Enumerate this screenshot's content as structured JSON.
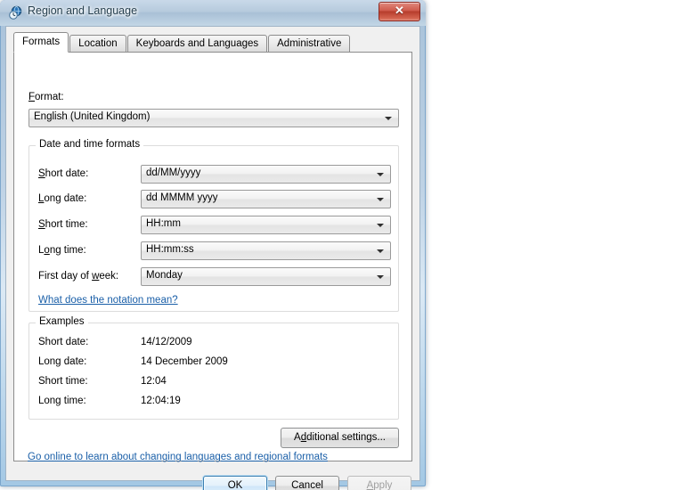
{
  "window": {
    "title": "Region and Language",
    "icon": "globe-clock-icon",
    "close_glyph": "✕"
  },
  "tabs": [
    {
      "label": "Formats",
      "active": true
    },
    {
      "label": "Location",
      "active": false
    },
    {
      "label": "Keyboards and Languages",
      "active": false
    },
    {
      "label": "Administrative",
      "active": false
    }
  ],
  "format_section": {
    "label_pre": "F",
    "label_post": "ormat:",
    "value": "English (United Kingdom)"
  },
  "datetime_group": {
    "title": "Date and time formats",
    "rows": [
      {
        "label_pre": "",
        "label_key": "S",
        "label_post": "hort date:",
        "value": "dd/MM/yyyy"
      },
      {
        "label_pre": "",
        "label_key": "L",
        "label_post": "ong date:",
        "value": "dd MMMM yyyy"
      },
      {
        "label_pre": "",
        "label_key": "S",
        "label_post": "hort time:",
        "value": "HH:mm"
      },
      {
        "label_pre": "L",
        "label_key": "o",
        "label_post": "ng time:",
        "value": "HH:mm:ss"
      },
      {
        "label_pre": "First day of ",
        "label_key": "w",
        "label_post": "eek:",
        "value": "Monday"
      }
    ],
    "notation_link": "What does the notation mean?"
  },
  "examples_group": {
    "title": "Examples",
    "rows": [
      {
        "label": "Short date:",
        "value": "14/12/2009"
      },
      {
        "label": "Long date:",
        "value": "14 December 2009"
      },
      {
        "label": "Short time:",
        "value": "12:04"
      },
      {
        "label": "Long time:",
        "value": "12:04:19"
      }
    ]
  },
  "additional_settings": {
    "label_pre": "A",
    "label_key": "d",
    "label_post": "ditional settings..."
  },
  "online_link": "Go online to learn about changing languages and regional formats",
  "buttons": {
    "ok": "OK",
    "cancel": "Cancel",
    "apply": "Apply",
    "apply_key": "A",
    "apply_rest": "pply"
  },
  "colors": {
    "link": "#1a5fa8",
    "titlebar": "#b6cadd",
    "close_button": "#b63c2c",
    "dialog_bg": "#f0f0f0",
    "page_bg": "#ffffff",
    "default_button_border": "#3c7fb1"
  }
}
